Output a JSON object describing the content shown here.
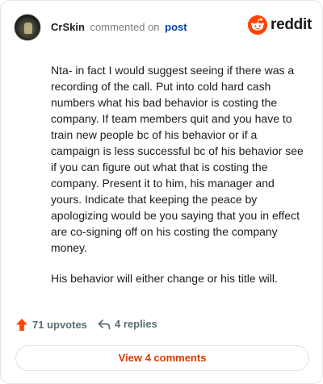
{
  "header": {
    "username": "CrSkin",
    "action": "commented on",
    "post_link": "post",
    "brand": "reddit"
  },
  "comment": {
    "paragraphs": [
      "Nta- in fact I would suggest seeing if there was a recording of the call. Put into cold hard cash numbers what his bad behavior is costing the company. If team members quit and you have to train new people bc of his behavior or if a campaign is less successful bc of his behavior see if you can figure out what that is costing the company. Present it to him, his manager and yours. Indicate that keeping the peace by apologizing would be you saying that you in effect are co-signing off on his costing the company money.",
      "His behavior will either change or his title will."
    ]
  },
  "stats": {
    "upvotes": "71 upvotes",
    "replies": "4 replies"
  },
  "actions": {
    "view_comments": "View 4 comments"
  },
  "colors": {
    "brand": "#ff4500",
    "link": "#0045ac",
    "cta": "#d93a00"
  },
  "icons": {
    "upvote": "upvote-arrow-icon",
    "reply": "reply-arrow-icon",
    "logo": "reddit-snoo-icon"
  }
}
